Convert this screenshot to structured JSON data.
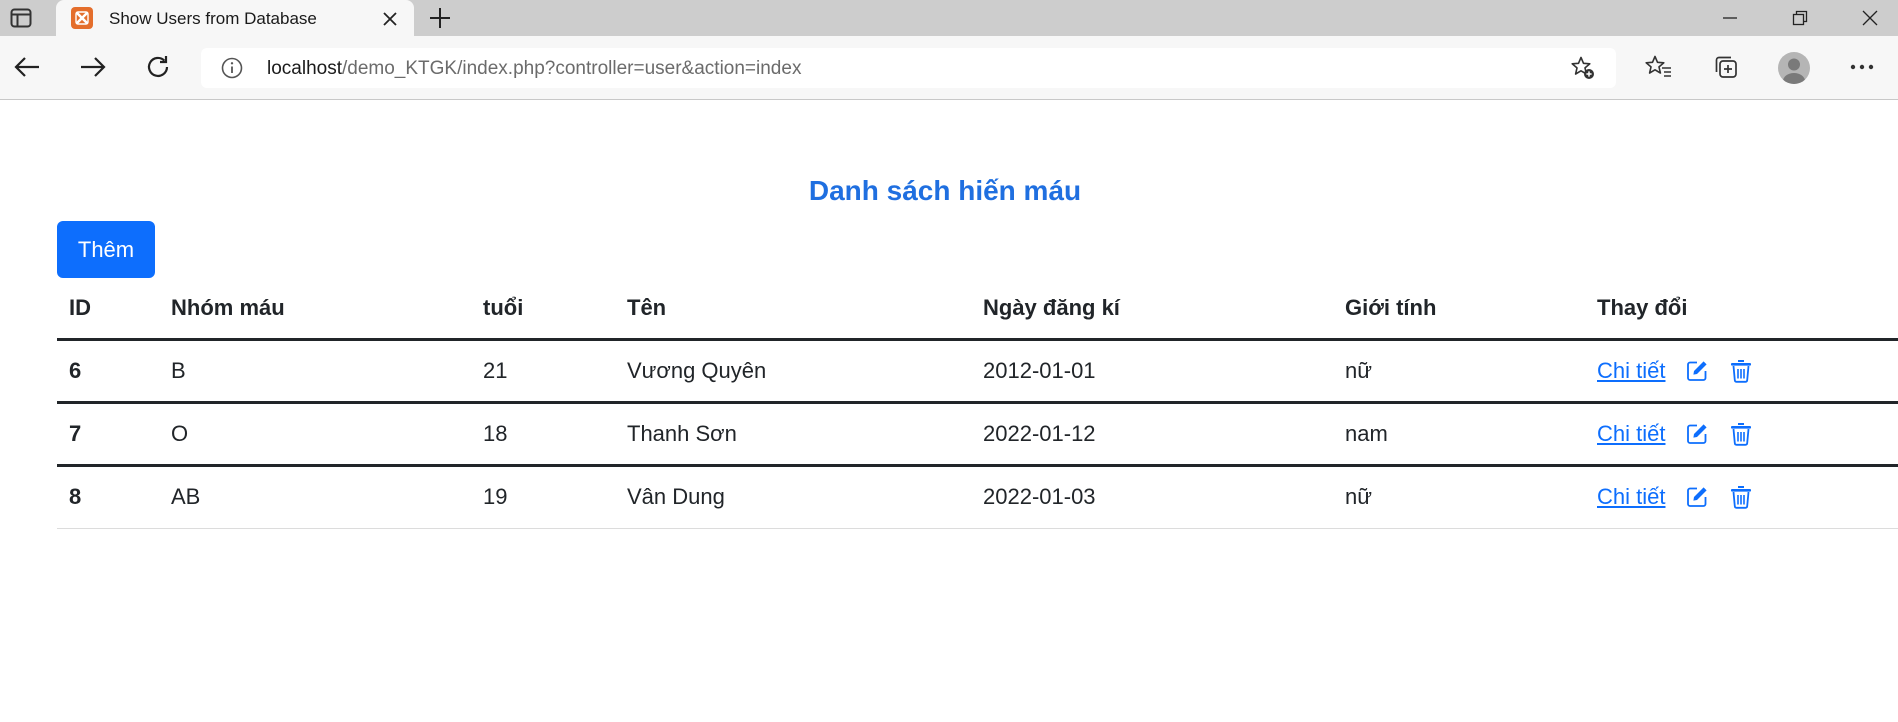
{
  "browser": {
    "tab_title": "Show Users from Database",
    "url_host": "localhost",
    "url_path": "/demo_KTGK/index.php?controller=user&action=index",
    "icons": [
      "tab-actions-icon",
      "xampp-favicon-icon",
      "close-icon",
      "plus-icon",
      "minimize-icon",
      "restore-icon",
      "close-window-icon",
      "back-arrow-icon",
      "forward-arrow-icon",
      "refresh-icon",
      "info-icon",
      "add-favorite-icon",
      "favorites-icon",
      "collections-icon",
      "profile-avatar-icon",
      "more-menu-icon"
    ]
  },
  "page": {
    "title": "Danh sách hiến máu",
    "add_button": "Thêm",
    "accent_color": "#0d6efd",
    "title_color": "#1f6fe0"
  },
  "table": {
    "headers": {
      "id": "ID",
      "blood_type": "Nhóm máu",
      "age": "tuổi",
      "name": "Tên",
      "date": "Ngày đăng kí",
      "gender": "Giới tính",
      "actions": "Thay đổi"
    },
    "rows": [
      {
        "id": "6",
        "blood_type": "B",
        "age": "21",
        "name": "Vương Quyên",
        "date": "2012-01-01",
        "gender": "nữ",
        "detail": "Chi tiết"
      },
      {
        "id": "7",
        "blood_type": "O",
        "age": "18",
        "name": "Thanh Sơn",
        "date": "2022-01-12",
        "gender": "nam",
        "detail": "Chi tiết"
      },
      {
        "id": "8",
        "blood_type": "AB",
        "age": "19",
        "name": "Vân Dung",
        "date": "2022-01-03",
        "gender": "nữ",
        "detail": "Chi tiết"
      }
    ]
  }
}
